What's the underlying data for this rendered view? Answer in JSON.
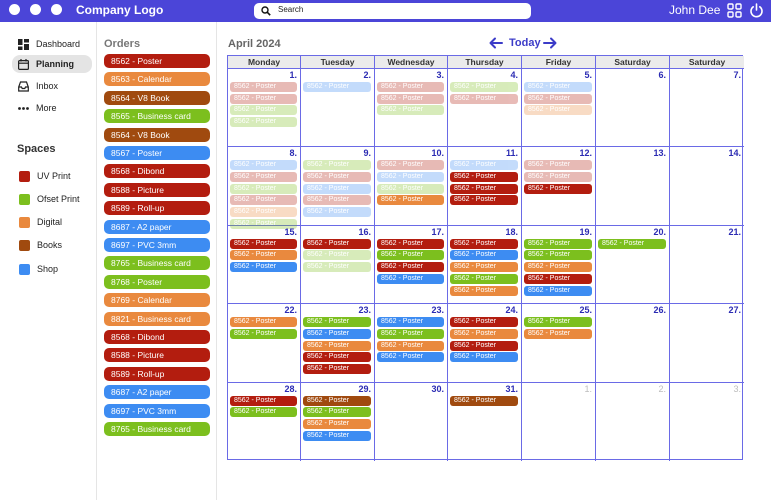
{
  "app": {
    "logo": "Company Logo",
    "user_name": "John Dee",
    "search_placeholder": "Search"
  },
  "colors": {
    "UV Print": "#b31d0f",
    "Ofset Print": "#7cbf1e",
    "Digital": "#e9893e",
    "Books": "#a04a0f",
    "Shop": "#3d8cf2"
  },
  "nav": {
    "items": [
      {
        "label": "Dashboard",
        "icon": "dashboard-icon"
      },
      {
        "label": "Planning",
        "icon": "calendar-icon",
        "active": true
      },
      {
        "label": "Inbox",
        "icon": "inbox-icon"
      },
      {
        "label": "More",
        "icon": "more-dots-icon"
      }
    ]
  },
  "spaces": {
    "title": "Spaces",
    "items": [
      {
        "label": "UV Print",
        "color": "#b31d0f"
      },
      {
        "label": "Ofset Print",
        "color": "#7cbf1e"
      },
      {
        "label": "Digital",
        "color": "#e9893e"
      },
      {
        "label": "Books",
        "color": "#a04a0f"
      },
      {
        "label": "Shop",
        "color": "#3d8cf2"
      }
    ]
  },
  "orders": {
    "title": "Orders",
    "items": [
      {
        "label": "8562 - Poster",
        "space": "UV Print"
      },
      {
        "label": "8563 - Calendar",
        "space": "Digital"
      },
      {
        "label": "8564 - V8 Book",
        "space": "Books"
      },
      {
        "label": "8565 - Business card",
        "space": "Ofset Print"
      },
      {
        "label": "8564 - V8 Book",
        "space": "Books"
      },
      {
        "label": "8567 - Poster",
        "space": "Shop"
      },
      {
        "label": "8568 - Dibond",
        "space": "UV Print"
      },
      {
        "label": "8588 - Picture",
        "space": "UV Print"
      },
      {
        "label": "8589 - Roll-up",
        "space": "UV Print"
      },
      {
        "label": "8687 - A2 paper",
        "space": "Shop"
      },
      {
        "label": "8697 - PVC 3mm",
        "space": "Shop"
      },
      {
        "label": "8765 - Business card",
        "space": "Ofset Print"
      },
      {
        "label": "8768 - Poster",
        "space": "Ofset Print"
      },
      {
        "label": "8769 - Calendar",
        "space": "Digital"
      },
      {
        "label": "8821 - Business card",
        "space": "Digital"
      },
      {
        "label": "8568 - Dibond",
        "space": "UV Print"
      },
      {
        "label": "8588 - Picture",
        "space": "UV Print"
      },
      {
        "label": "8589 - Roll-up",
        "space": "UV Print"
      },
      {
        "label": "8687 - A2 paper",
        "space": "Shop"
      },
      {
        "label": "8697 - PVC 3mm",
        "space": "Shop"
      },
      {
        "label": "8765 - Business card",
        "space": "Ofset Print"
      }
    ]
  },
  "calendar": {
    "month_label": "April 2024",
    "today_label": "Today",
    "weekdays": [
      "Monday",
      "Tuesday",
      "Wednesday",
      "Thursday",
      "Friday",
      "Saturday",
      "Saturday"
    ],
    "weeks": [
      [
        {
          "day": "1.",
          "events": [
            {
              "label": "8562 - Poster",
              "space": "UV Print",
              "faded": true
            },
            {
              "label": "8562 - Poster",
              "space": "UV Print",
              "faded": true
            },
            {
              "label": "8562 - Poster",
              "space": "Ofset Print",
              "faded": true
            },
            {
              "label": "8562 - Poster",
              "space": "Ofset Print",
              "faded": true
            }
          ]
        },
        {
          "day": "2.",
          "events": [
            {
              "label": "8562 - Poster",
              "space": "Shop",
              "faded": true
            }
          ]
        },
        {
          "day": "3.",
          "events": [
            {
              "label": "8562 - Poster",
              "space": "UV Print",
              "faded": true
            },
            {
              "label": "8562 - Poster",
              "space": "UV Print",
              "faded": true
            },
            {
              "label": "8562 - Poster",
              "space": "Ofset Print",
              "faded": true
            }
          ]
        },
        {
          "day": "4.",
          "events": [
            {
              "label": "8562 - Poster",
              "space": "Ofset Print",
              "faded": true
            },
            {
              "label": "8562 - Poster",
              "space": "UV Print",
              "faded": true
            }
          ]
        },
        {
          "day": "5.",
          "events": [
            {
              "label": "8562 - Poster",
              "space": "Shop",
              "faded": true
            },
            {
              "label": "8562 - Poster",
              "space": "UV Print",
              "faded": true
            },
            {
              "label": "8562 - Poster",
              "space": "Digital",
              "faded": true
            }
          ]
        },
        {
          "day": "6.",
          "events": []
        },
        {
          "day": "7.",
          "events": []
        }
      ],
      [
        {
          "day": "8.",
          "events": [
            {
              "label": "8562 - Poster",
              "space": "Shop",
              "faded": true
            },
            {
              "label": "8562 - Poster",
              "space": "UV Print",
              "faded": true
            },
            {
              "label": "8562 - Poster",
              "space": "Ofset Print",
              "faded": true
            },
            {
              "label": "8562 - Poster",
              "space": "UV Print",
              "faded": true
            },
            {
              "label": "8562 - Poster",
              "space": "Digital",
              "faded": true
            },
            {
              "label": "8562 - Poster",
              "space": "Ofset Print",
              "faded": true
            }
          ]
        },
        {
          "day": "9.",
          "events": [
            {
              "label": "8562 - Poster",
              "space": "Ofset Print",
              "faded": true
            },
            {
              "label": "8562 - Poster",
              "space": "UV Print",
              "faded": true
            },
            {
              "label": "8562 - Poster",
              "space": "Shop",
              "faded": true
            },
            {
              "label": "8562 - Poster",
              "space": "UV Print",
              "faded": true
            },
            {
              "label": "8562 - Poster",
              "space": "Shop",
              "faded": true
            }
          ]
        },
        {
          "day": "10.",
          "events": [
            {
              "label": "8562 - Poster",
              "space": "UV Print",
              "faded": true
            },
            {
              "label": "8562 - Poster",
              "space": "Shop",
              "faded": true
            },
            {
              "label": "8562 - Poster",
              "space": "Ofset Print",
              "faded": true
            },
            {
              "label": "8562 - Poster",
              "space": "Digital"
            }
          ]
        },
        {
          "day": "11.",
          "events": [
            {
              "label": "8562 - Poster",
              "space": "Shop",
              "faded": true
            },
            {
              "label": "8562 - Poster",
              "space": "UV Print"
            },
            {
              "label": "8562 - Poster",
              "space": "UV Print"
            },
            {
              "label": "8562 - Poster",
              "space": "UV Print"
            }
          ]
        },
        {
          "day": "12.",
          "events": [
            {
              "label": "8562 - Poster",
              "space": "UV Print",
              "faded": true
            },
            {
              "label": "8562 - Poster",
              "space": "UV Print",
              "faded": true
            },
            {
              "label": "8562 - Poster",
              "space": "UV Print"
            }
          ]
        },
        {
          "day": "13.",
          "events": []
        },
        {
          "day": "14.",
          "events": []
        }
      ],
      [
        {
          "day": "15.",
          "events": [
            {
              "label": "8562 - Poster",
              "space": "UV Print"
            },
            {
              "label": "8562 - Poster",
              "space": "Digital"
            },
            {
              "label": "8562 - Poster",
              "space": "Shop"
            }
          ]
        },
        {
          "day": "16.",
          "events": [
            {
              "label": "8562 - Poster",
              "space": "UV Print"
            },
            {
              "label": "8562 - Poster",
              "space": "Ofset Print",
              "faded": true
            },
            {
              "label": "8562 - Poster",
              "space": "Ofset Print",
              "faded": true
            }
          ]
        },
        {
          "day": "17.",
          "events": [
            {
              "label": "8562 - Poster",
              "space": "UV Print"
            },
            {
              "label": "8562 - Poster",
              "space": "Ofset Print"
            },
            {
              "label": "8562 - Poster",
              "space": "UV Print"
            },
            {
              "label": "8562 - Poster",
              "space": "Shop"
            }
          ]
        },
        {
          "day": "18.",
          "events": [
            {
              "label": "8562 - Poster",
              "space": "UV Print"
            },
            {
              "label": "8562 - Poster",
              "space": "Shop"
            },
            {
              "label": "8562 - Poster",
              "space": "Digital"
            },
            {
              "label": "8562 - Poster",
              "space": "Ofset Print"
            },
            {
              "label": "8562 - Poster",
              "space": "Digital"
            }
          ]
        },
        {
          "day": "19.",
          "events": [
            {
              "label": "8562 - Poster",
              "space": "Ofset Print"
            },
            {
              "label": "8562 - Poster",
              "space": "Ofset Print"
            },
            {
              "label": "8562 - Poster",
              "space": "Digital"
            },
            {
              "label": "8562 - Poster",
              "space": "UV Print"
            },
            {
              "label": "8562 - Poster",
              "space": "Shop"
            }
          ]
        },
        {
          "day": "20.",
          "events": [
            {
              "label": "8562 - Poster",
              "space": "Ofset Print"
            }
          ]
        },
        {
          "day": "21.",
          "events": []
        }
      ],
      [
        {
          "day": "22.",
          "events": [
            {
              "label": "8562 - Poster",
              "space": "Digital"
            },
            {
              "label": "8562 - Poster",
              "space": "Ofset Print"
            }
          ]
        },
        {
          "day": "23.",
          "events": [
            {
              "label": "8562 - Poster",
              "space": "Ofset Print"
            },
            {
              "label": "8562 - Poster",
              "space": "Shop"
            },
            {
              "label": "8562 - Poster",
              "space": "Digital"
            },
            {
              "label": "8562 - Poster",
              "space": "UV Print"
            },
            {
              "label": "8562 - Poster",
              "space": "UV Print"
            }
          ]
        },
        {
          "day": "23.",
          "events": [
            {
              "label": "8562 - Poster",
              "space": "Shop"
            },
            {
              "label": "8562 - Poster",
              "space": "Ofset Print"
            },
            {
              "label": "8562 - Poster",
              "space": "Digital"
            },
            {
              "label": "8562 - Poster",
              "space": "Shop"
            }
          ]
        },
        {
          "day": "24.",
          "events": [
            {
              "label": "8562 - Poster",
              "space": "UV Print"
            },
            {
              "label": "8562 - Poster",
              "space": "Digital"
            },
            {
              "label": "8562 - Poster",
              "space": "UV Print"
            },
            {
              "label": "8562 - Poster",
              "space": "Shop"
            }
          ]
        },
        {
          "day": "25.",
          "events": [
            {
              "label": "8562 - Poster",
              "space": "Ofset Print"
            },
            {
              "label": "8562 - Poster",
              "space": "Digital"
            }
          ]
        },
        {
          "day": "26.",
          "events": []
        },
        {
          "day": "27.",
          "events": []
        }
      ],
      [
        {
          "day": "28.",
          "events": [
            {
              "label": "8562 - Poster",
              "space": "UV Print"
            },
            {
              "label": "8562 - Poster",
              "space": "Ofset Print"
            }
          ]
        },
        {
          "day": "29.",
          "events": [
            {
              "label": "8562 - Poster",
              "space": "Books"
            },
            {
              "label": "8562 - Poster",
              "space": "Ofset Print"
            },
            {
              "label": "8562 - Poster",
              "space": "Digital"
            },
            {
              "label": "8562 - Poster",
              "space": "Shop"
            }
          ]
        },
        {
          "day": "30.",
          "events": []
        },
        {
          "day": "31.",
          "events": [
            {
              "label": "8562 - Poster",
              "space": "Books"
            }
          ]
        },
        {
          "day": "1.",
          "muted": true,
          "events": []
        },
        {
          "day": "2.",
          "muted": true,
          "events": []
        },
        {
          "day": "3.",
          "muted": true,
          "events": []
        }
      ]
    ]
  }
}
